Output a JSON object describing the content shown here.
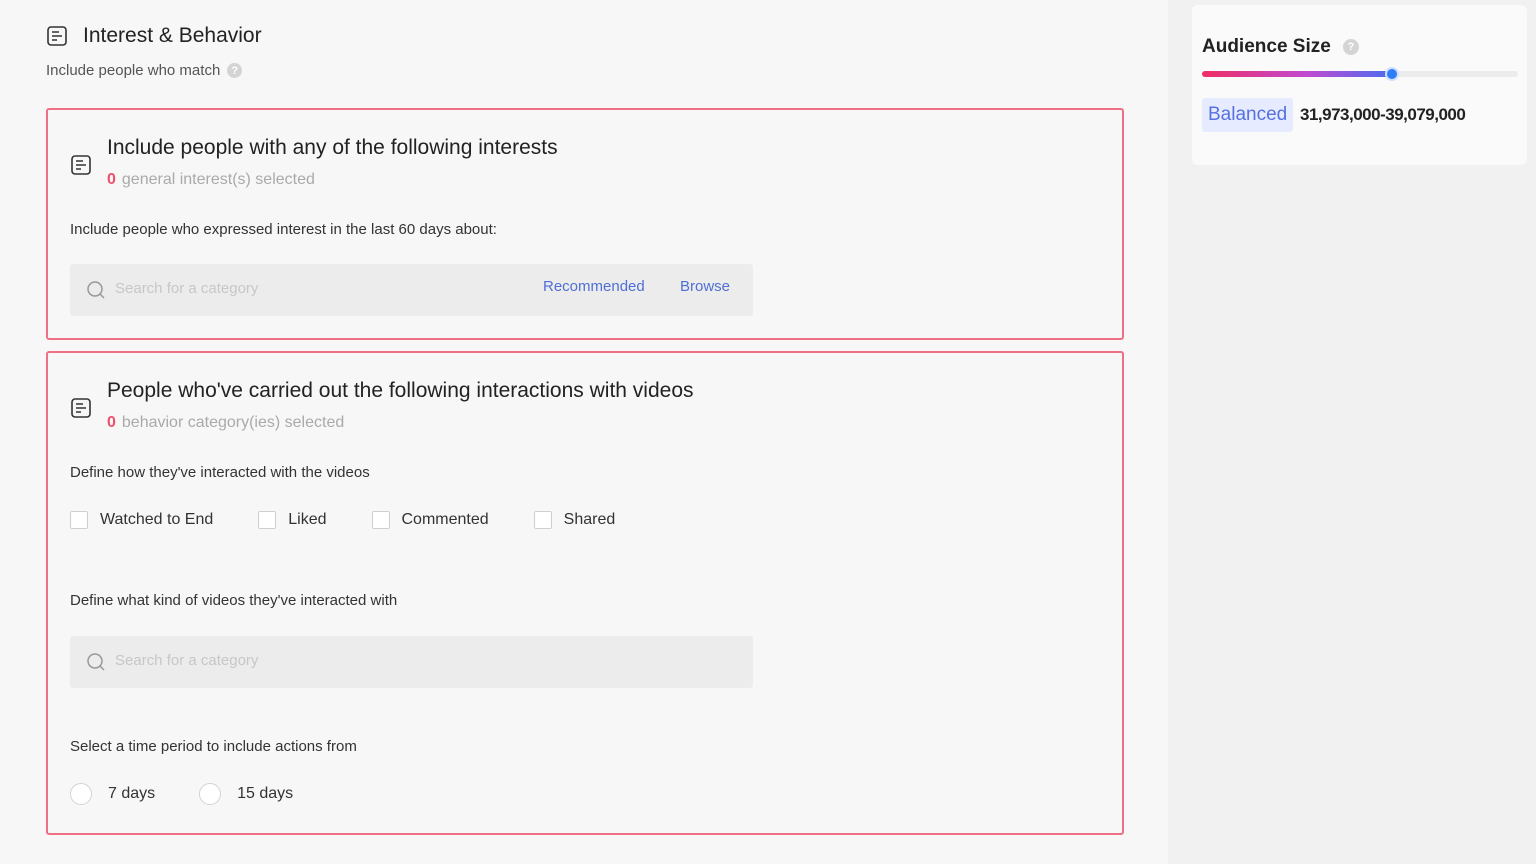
{
  "section": {
    "title": "Interest & Behavior",
    "subtitle": "Include people who match"
  },
  "interests": {
    "title": "Include people with any of the following interests",
    "count": "0",
    "count_suffix": "general interest(s) selected",
    "label": "Include people who expressed interest in the last 60 days about:",
    "search_placeholder": "Search for a category",
    "recommended_label": "Recommended",
    "browse_label": "Browse"
  },
  "behaviors": {
    "title": "People who've carried out the following interactions with videos",
    "count": "0",
    "count_suffix": "behavior category(ies) selected",
    "interaction_label": "Define how they've interacted with the videos",
    "interactions": [
      {
        "label": "Watched to End",
        "checked": false
      },
      {
        "label": "Liked",
        "checked": false
      },
      {
        "label": "Commented",
        "checked": false
      },
      {
        "label": "Shared",
        "checked": false
      }
    ],
    "video_kind_label": "Define what kind of videos they've interacted with",
    "search_placeholder": "Search for a category",
    "time_period_label": "Select a time period to include actions from",
    "time_periods": [
      {
        "label": "7 days",
        "selected": false
      },
      {
        "label": "15 days",
        "selected": false
      }
    ]
  },
  "audience": {
    "title": "Audience Size",
    "level": "Balanced",
    "range": "31,973,000-39,079,000",
    "slider_fraction": 0.6
  },
  "colors": {
    "accent_red": "#f0506e",
    "link_blue": "#4f6fd6",
    "card_border": "#ef6f86"
  }
}
